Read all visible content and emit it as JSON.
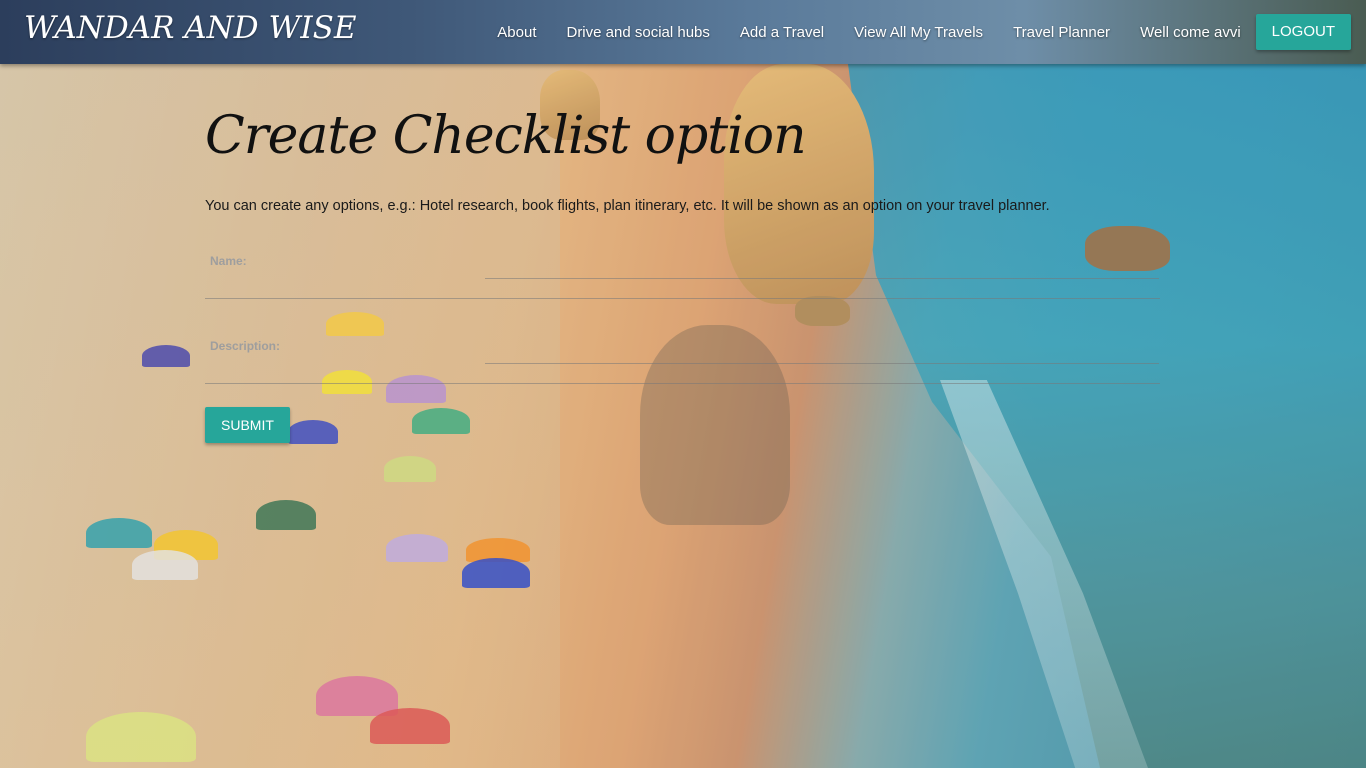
{
  "brand": {
    "name": "WANDAR AND WISE"
  },
  "nav": {
    "links": [
      {
        "label": "About"
      },
      {
        "label": "Drive and social hubs"
      },
      {
        "label": "Add a Travel"
      },
      {
        "label": "View All My Travels"
      },
      {
        "label": "Travel Planner"
      },
      {
        "label": "Well come avvi"
      }
    ],
    "logout_label": "LOGOUT"
  },
  "page": {
    "title": "Create Checklist option",
    "subtitle": "You can create any options, e.g.: Hotel research, book flights, plan itinerary, etc. It will be shown as an option on your travel planner."
  },
  "form": {
    "name_label": "Name:",
    "name_value": "",
    "description_label": "Description:",
    "description_value": "",
    "submit_label": "SUBMIT"
  },
  "colors": {
    "accent": "#26a69a",
    "title_text": "#111111",
    "label_text": "#9e9e9e"
  }
}
